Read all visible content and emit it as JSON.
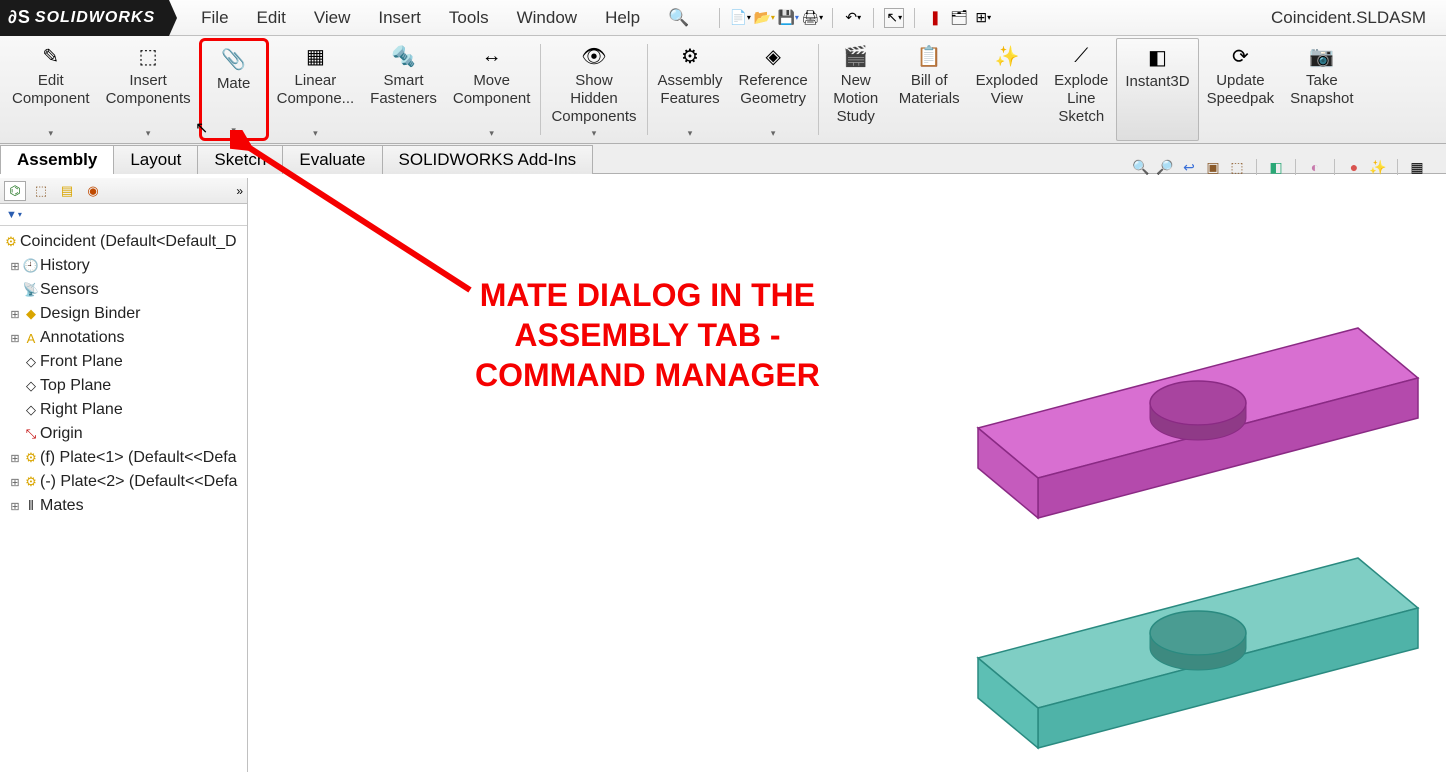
{
  "app": {
    "name": "SOLIDWORKS",
    "document": "Coincident.SLDASM"
  },
  "menubar": [
    "File",
    "Edit",
    "View",
    "Insert",
    "Tools",
    "Window",
    "Help"
  ],
  "ribbon": [
    {
      "id": "edit-component",
      "label": "Edit\nComponent",
      "icon": "✎",
      "dd": true
    },
    {
      "id": "insert-components",
      "label": "Insert\nComponents",
      "icon": "⬚",
      "dd": true
    },
    {
      "id": "mate",
      "label": "Mate",
      "icon": "📎",
      "dd": true,
      "highlight": true
    },
    {
      "id": "linear-component",
      "label": "Linear\nCompone...",
      "icon": "▦",
      "dd": true
    },
    {
      "id": "smart-fasteners",
      "label": "Smart\nFasteners",
      "icon": "🔩"
    },
    {
      "id": "move-component",
      "label": "Move\nComponent",
      "icon": "↔",
      "dd": true
    },
    {
      "split": true
    },
    {
      "id": "show-hidden",
      "label": "Show\nHidden\nComponents",
      "icon": "👁",
      "dd": true
    },
    {
      "split": true
    },
    {
      "id": "assembly-features",
      "label": "Assembly\nFeatures",
      "icon": "⚙",
      "dd": true
    },
    {
      "id": "reference-geometry",
      "label": "Reference\nGeometry",
      "icon": "◈",
      "dd": true
    },
    {
      "split": true
    },
    {
      "id": "new-motion-study",
      "label": "New\nMotion\nStudy",
      "icon": "🎬"
    },
    {
      "id": "bill-of-materials",
      "label": "Bill of\nMaterials",
      "icon": "📋"
    },
    {
      "id": "exploded-view",
      "label": "Exploded\nView",
      "icon": "✨"
    },
    {
      "id": "explode-line-sketch",
      "label": "Explode\nLine\nSketch",
      "icon": "⟋"
    },
    {
      "id": "instant3d",
      "label": "Instant3D",
      "icon": "◧",
      "active": true
    },
    {
      "id": "update-speedpak",
      "label": "Update\nSpeedpak",
      "icon": "⟳"
    },
    {
      "id": "take-snapshot",
      "label": "Take\nSnapshot",
      "icon": "📷"
    }
  ],
  "tabs": [
    {
      "id": "assembly",
      "label": "Assembly",
      "active": true
    },
    {
      "id": "layout",
      "label": "Layout"
    },
    {
      "id": "sketch",
      "label": "Sketch"
    },
    {
      "id": "evaluate",
      "label": "Evaluate"
    },
    {
      "id": "addins",
      "label": "SOLIDWORKS Add-Ins"
    }
  ],
  "tree": {
    "root": "Coincident  (Default<Default_D",
    "nodes": [
      {
        "icon": "🕘",
        "label": "History",
        "exp": "⊞"
      },
      {
        "icon": "📡",
        "label": "Sensors"
      },
      {
        "icon": "◆",
        "label": "Design Binder",
        "exp": "⊞",
        "color": "#d9a500"
      },
      {
        "icon": "A",
        "label": "Annotations",
        "exp": "⊞",
        "color": "#d9a500"
      },
      {
        "icon": "◇",
        "label": "Front Plane"
      },
      {
        "icon": "◇",
        "label": "Top Plane"
      },
      {
        "icon": "◇",
        "label": "Right Plane"
      },
      {
        "icon": "⤡",
        "label": "Origin",
        "color": "#c00000"
      },
      {
        "icon": "⚙",
        "label": "(f) Plate<1> (Default<<Defa",
        "exp": "⊞",
        "color": "#d9a500"
      },
      {
        "icon": "⚙",
        "label": "(-) Plate<2> (Default<<Defa",
        "exp": "⊞",
        "color": "#d9a500"
      },
      {
        "icon": "⫴",
        "label": "Mates",
        "exp": "⊞"
      }
    ]
  },
  "annotation": "MATE DIALOG IN THE\nASSEMBLY TAB -\nCOMMAND MANAGER"
}
